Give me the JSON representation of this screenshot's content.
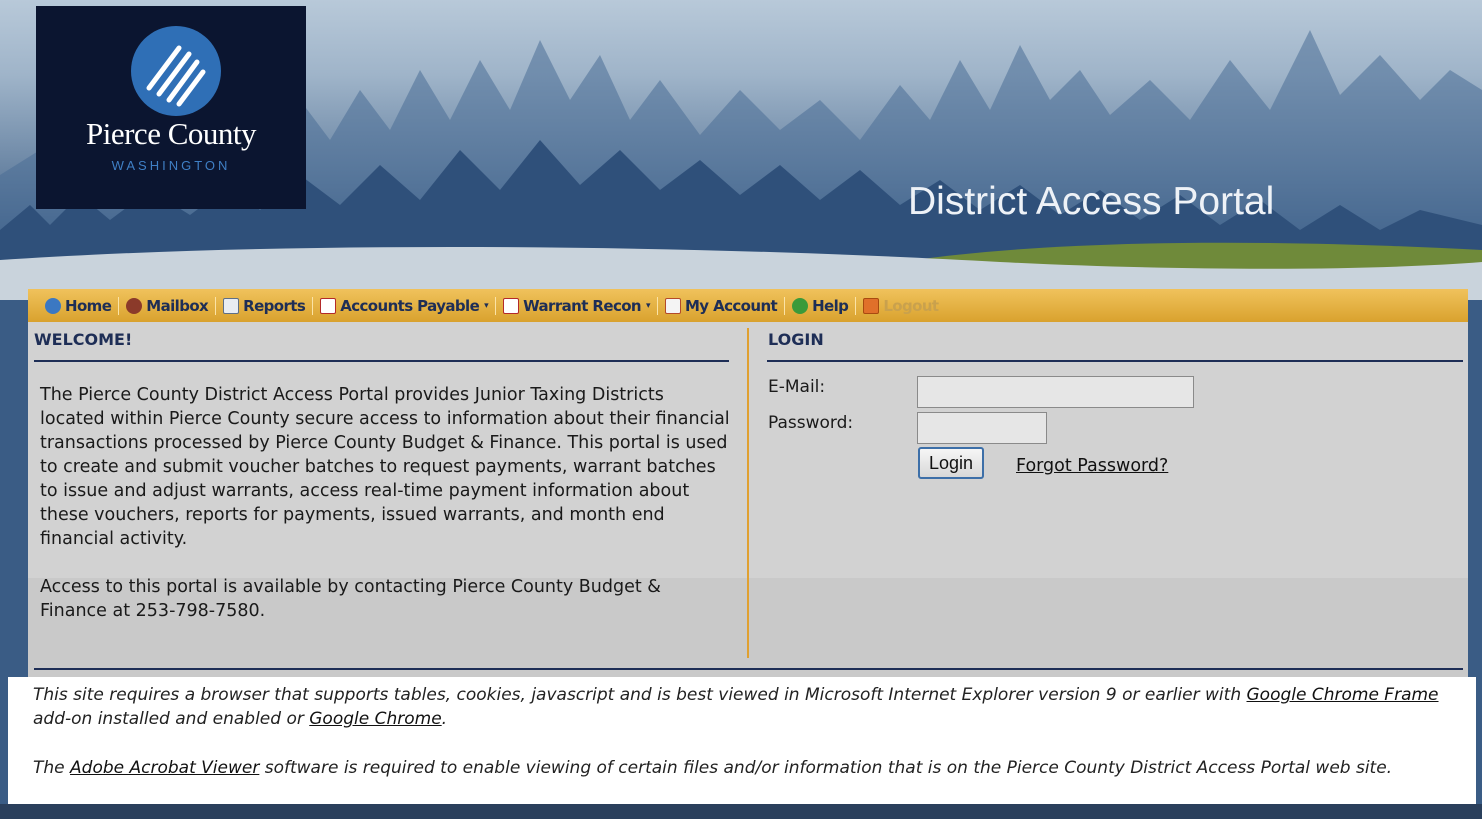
{
  "header": {
    "logo_name": "Pierce County",
    "logo_state": "WASHINGTON",
    "portal_title": "District Access Portal"
  },
  "nav": {
    "items": [
      {
        "label": "Home",
        "icon": "home-icon"
      },
      {
        "label": "Mailbox",
        "icon": "mailbox-icon"
      },
      {
        "label": "Reports",
        "icon": "reports-icon"
      },
      {
        "label": "Accounts Payable",
        "icon": "document-icon",
        "dropdown": true
      },
      {
        "label": "Warrant Recon",
        "icon": "document-icon",
        "dropdown": true
      },
      {
        "label": "My Account",
        "icon": "checklist-icon"
      },
      {
        "label": "Help",
        "icon": "help-icon"
      },
      {
        "label": "Logout",
        "icon": "power-icon",
        "disabled": true
      }
    ],
    "dropdown_caret": "▾"
  },
  "welcome": {
    "title": "WELCOME!",
    "paragraph1": "The Pierce County District Access Portal provides Junior Taxing Districts located within Pierce County secure access to information about their financial transactions processed by Pierce County Budget & Finance. This portal is used to create and submit voucher batches to request payments, warrant batches to issue and adjust warrants, access real-time payment information about these vouchers, reports for payments, issued warrants, and month end financial activity.",
    "paragraph2": "Access to this portal is available by contacting Pierce County Budget & Finance at 253-798-7580."
  },
  "login": {
    "title": "LOGIN",
    "email_label": "E-Mail:",
    "email_value": "",
    "password_label": "Password:",
    "password_value": "",
    "login_button": "Login",
    "forgot_link": "Forgot Password?"
  },
  "notice": {
    "line1_a": "This site requires a browser that supports tables, cookies, javascript and is best viewed in Microsoft Internet Explorer version 9 or earlier with ",
    "link_chrome_frame": "Google Chrome Frame",
    "line1_b": " add-on installed and enabled or ",
    "link_chrome": "Google Chrome",
    "line1_c": ".",
    "line2_a": "The ",
    "link_acrobat": "Adobe Acrobat Viewer",
    "line2_b": " software is required to enable viewing of certain files and/or information that is on the Pierce County District Access Portal web site."
  },
  "colors": {
    "navy": "#1e2e56",
    "nav_gold": "#d9a22e",
    "divider_gold": "#e0a030",
    "panel_gray": "#d2d2d2"
  }
}
